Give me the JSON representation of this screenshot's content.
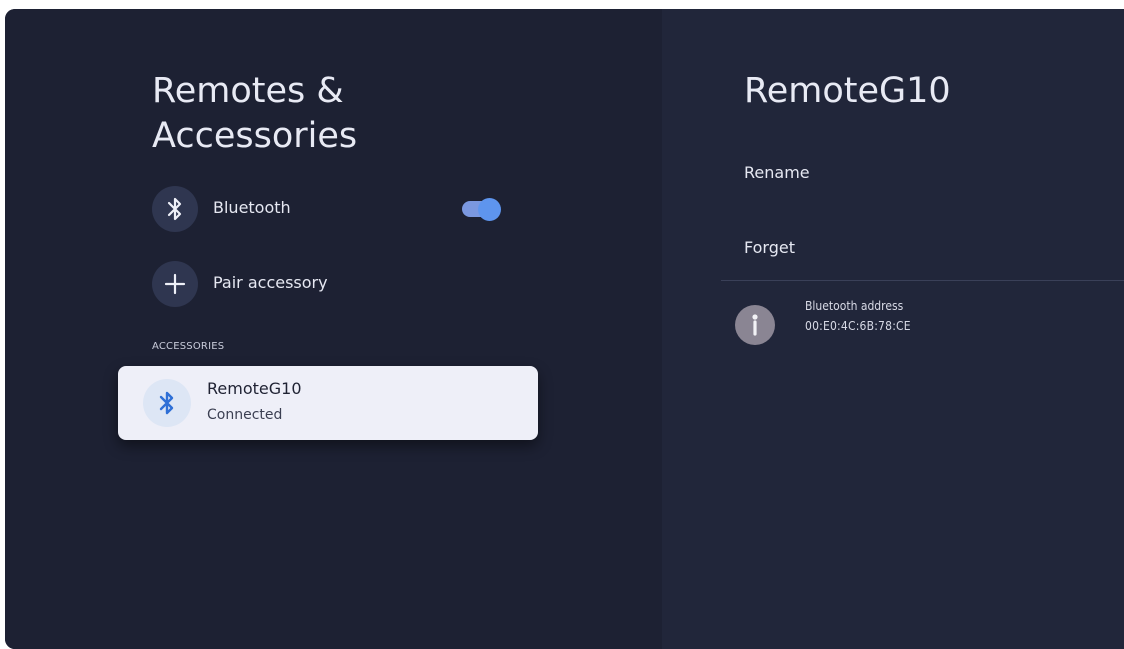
{
  "left_panel": {
    "title": "Remotes &\nAccessories",
    "rows": [
      {
        "label": "Bluetooth",
        "icon": "bluetooth-icon",
        "toggle_on": true
      },
      {
        "label": "Pair accessory",
        "icon": "plus-icon"
      }
    ],
    "section_header": "ACCESSORIES",
    "devices": [
      {
        "name": "RemoteG10",
        "status": "Connected",
        "icon": "bluetooth-icon"
      }
    ]
  },
  "right_panel": {
    "title": "RemoteG10",
    "actions": [
      {
        "label": "Rename"
      },
      {
        "label": "Forget"
      }
    ],
    "info": {
      "icon": "info-icon",
      "label": "Bluetooth address",
      "value": "00:E0:4C:6B:78:CE"
    }
  },
  "colors": {
    "background": "#1d2132",
    "right_panel": "#21263a",
    "toggle_accent": "#5e95ee",
    "card": "#eeeff8",
    "bluetooth_icon_active": "#2e6fd6"
  }
}
